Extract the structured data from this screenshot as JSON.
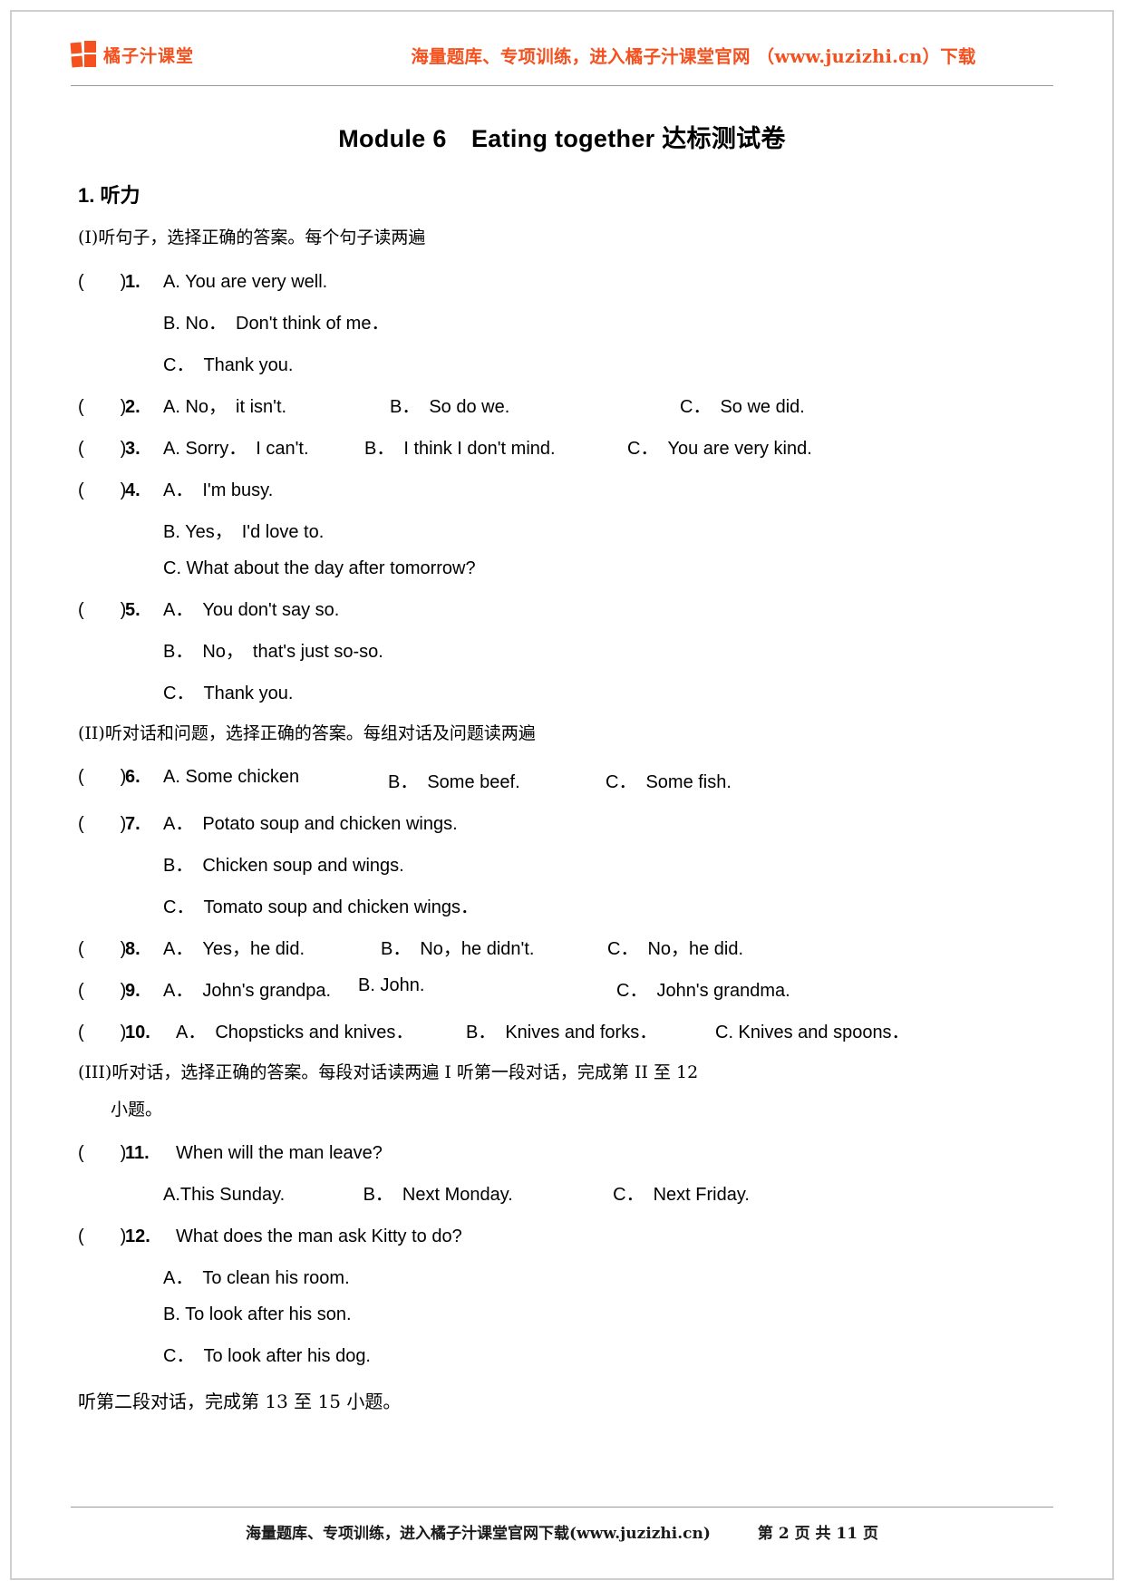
{
  "header": {
    "brand_name": "橘子汁课堂",
    "banner": "海量题库、专项训练，进入橘子汁课堂官网 （www.juzizhi.cn）下载",
    "brand_color": "#f4511e"
  },
  "title": "Module 6　Eating together 达标测试卷",
  "section": {
    "number_label": "1. 听力",
    "part1_directive": "(I)听句子，选择正确的答案。每个句子读两遍",
    "part2_directive": "(II)听对话和问题，选择正确的答案。每组对话及问题读两遍",
    "part3_directive_line1": "(III)听对话，选择正确的答案。每段对话读两遍 I 听第一段对话，完成第 II 至 12",
    "part3_directive_line2": "小题。",
    "tail_note": "听第二段对话，完成第 13 至 15 小题。"
  },
  "bracket": "(　　)",
  "questions": [
    {
      "num": "1.",
      "layout": "stacked",
      "options": [
        "A. You are very well.",
        "B. No．　Don't think of me．",
        "C．　Thank you."
      ]
    },
    {
      "num": "2.",
      "layout": "inline",
      "options": [
        "A. No，　it isn't.",
        "B．　So do we.",
        "C．　So we did."
      ],
      "widths": [
        250,
        320,
        0
      ]
    },
    {
      "num": "3.",
      "layout": "inline",
      "options": [
        "A. Sorry．　I can't.",
        "B．　I think I don't mind.",
        "C．　You are very kind."
      ],
      "widths": [
        222,
        290,
        0
      ]
    },
    {
      "num": "4.",
      "layout": "stacked",
      "options": [
        "A．　I'm busy.",
        "B. Yes，　I'd love to.",
        "C. What about the day after tomorrow?"
      ]
    },
    {
      "num": "5.",
      "layout": "stacked",
      "options": [
        "A．　You don't say so.",
        "B．　No，　that's just so-so.",
        "C．　Thank you."
      ]
    },
    {
      "num": "6.",
      "layout": "inline",
      "options": [
        "A. Some chicken",
        "B．　Some beef.",
        "C．　Some fish."
      ],
      "widths": [
        248,
        240,
        0
      ]
    },
    {
      "num": "7.",
      "layout": "stacked",
      "options": [
        "A．　Potato soup and chicken wings.",
        "B．　Chicken soup and wings.",
        "C．　Tomato soup and chicken wings．"
      ]
    },
    {
      "num": "8.",
      "layout": "inline",
      "options": [
        "A．　Yes，he did.",
        "B．　No，he didn't.",
        "C．　No，he did."
      ],
      "widths": [
        240,
        250,
        0
      ]
    },
    {
      "num": "9.",
      "layout": "inline",
      "options": [
        "A．　John's grandpa.",
        "B. John.",
        "C．　John's grandma."
      ],
      "widths": [
        215,
        285,
        0
      ]
    },
    {
      "num": "10.",
      "layout": "inline",
      "options": [
        "A．　Chopsticks and knives．",
        "B．　Knives and forks．",
        "C. Knives and spoons．"
      ],
      "widths": [
        320,
        275,
        0
      ]
    },
    {
      "num": "11.",
      "layout": "stacked-question",
      "stem": "When will the man leave?",
      "options_inline": [
        "A.This Sunday.",
        "B．　Next Monday.",
        "C．　Next Friday."
      ],
      "inline_widths": [
        215,
        270,
        0
      ]
    },
    {
      "num": "12.",
      "layout": "stacked-question",
      "stem": "What does the man ask Kitty to do?",
      "options": [
        "A．　To clean his room.",
        "B. To look after his son.",
        "C．　To look after his dog."
      ]
    }
  ],
  "footer": {
    "note": "海量题库、专项训练，进入橘子汁课堂官网下载(www.juzizhi.cn)",
    "page": "第 2 页 共 11 页"
  }
}
